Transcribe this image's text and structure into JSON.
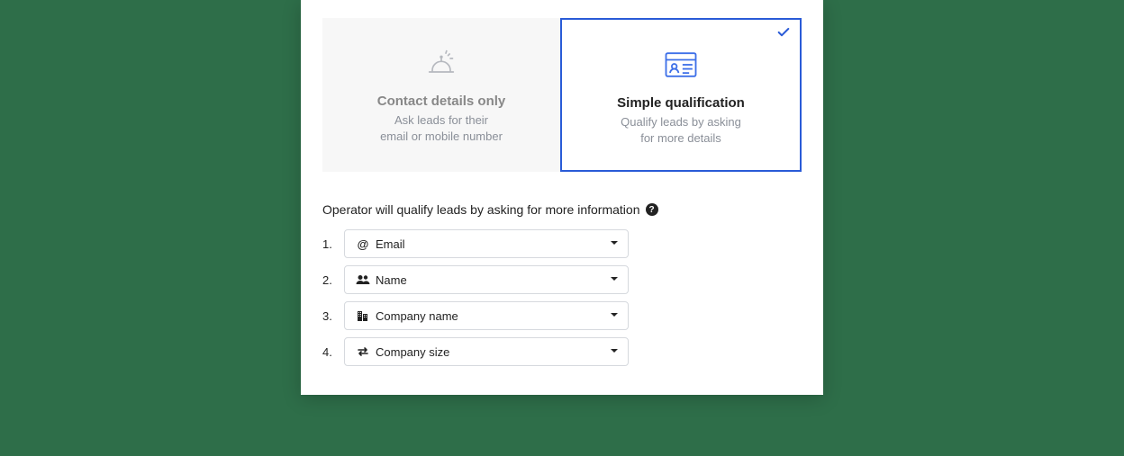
{
  "cards": {
    "contact": {
      "title": "Contact details only",
      "sub": "Ask leads for their\nemail or mobile number",
      "selected": false
    },
    "qualification": {
      "title": "Simple qualification",
      "sub": "Qualify leads by asking\nfor more details",
      "selected": true
    }
  },
  "lead_text": "Operator will qualify leads by asking for more information",
  "fields": [
    {
      "num": "1.",
      "label": "Email",
      "icon": "at-icon"
    },
    {
      "num": "2.",
      "label": "Name",
      "icon": "people-icon"
    },
    {
      "num": "3.",
      "label": "Company name",
      "icon": "building-icon"
    },
    {
      "num": "4.",
      "label": "Company size",
      "icon": "swap-icon"
    }
  ]
}
